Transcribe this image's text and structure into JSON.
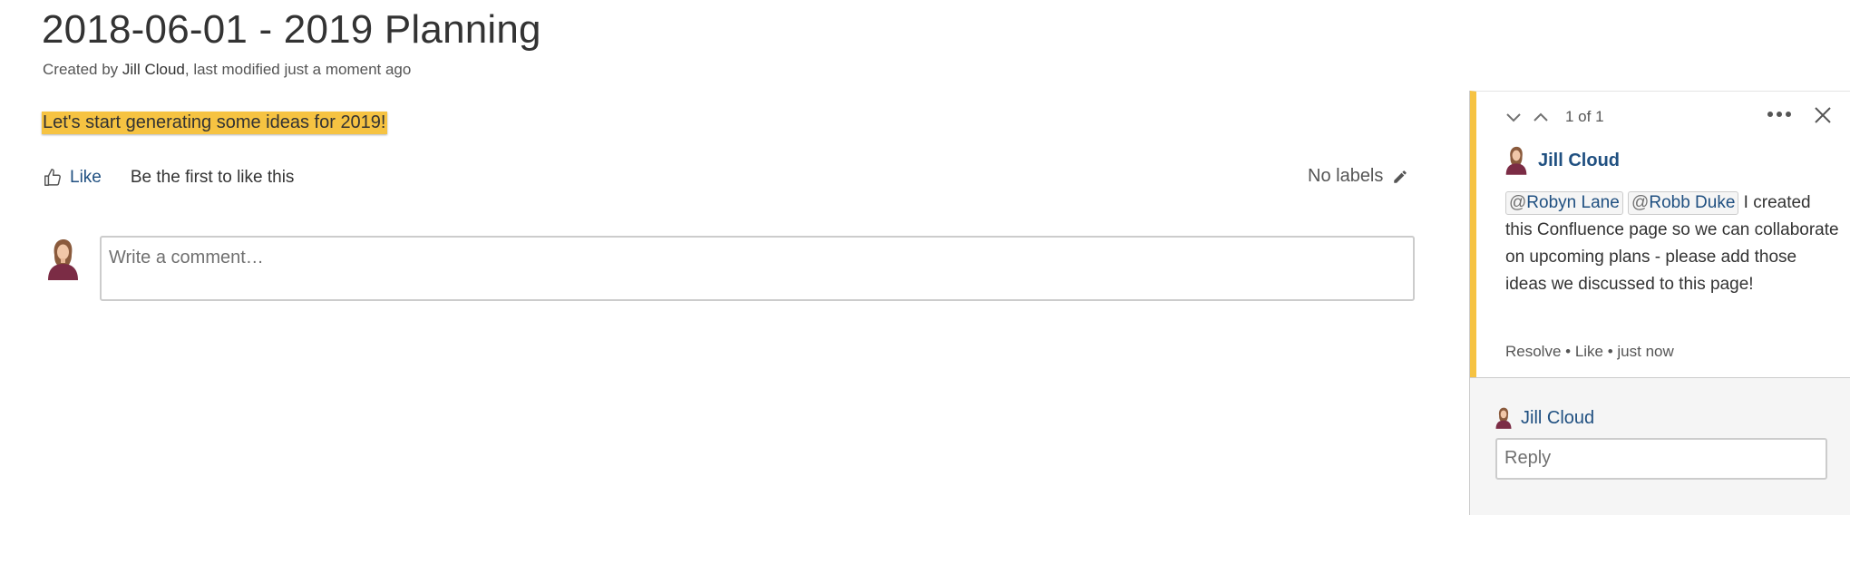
{
  "page": {
    "title": "2018-06-01 - 2019 Planning",
    "byline_prefix": "Created by ",
    "byline_author": "Jill Cloud",
    "byline_suffix": ", last modified just a moment ago",
    "highlighted_text": "Let's start generating some ideas for 2019!"
  },
  "likes": {
    "like_label": "Like",
    "summary": "Be the first to like this"
  },
  "labels": {
    "text": "No labels"
  },
  "comment_editor": {
    "placeholder": "Write a comment…"
  },
  "inline_comment": {
    "counter": "1 of 1",
    "author": "Jill Cloud",
    "mentions": [
      {
        "at": "@",
        "name": "Robyn Lane"
      },
      {
        "at": "@",
        "name": "Robb Duke"
      }
    ],
    "body": " I created this Confluence page so we can collaborate on upcoming plans - please add those ideas we discussed to this page!",
    "meta": "Resolve • Like • just now",
    "reply_author": "Jill Cloud",
    "reply_placeholder": "Reply"
  },
  "colors": {
    "highlight": "#f6c342",
    "link": "#205081",
    "avatar_shirt": "#7b2c45"
  },
  "icons": [
    "thumbs-up-icon",
    "pencil-icon",
    "avatar-icon",
    "chevron-down-icon",
    "chevron-up-icon",
    "more-icon",
    "close-icon"
  ]
}
